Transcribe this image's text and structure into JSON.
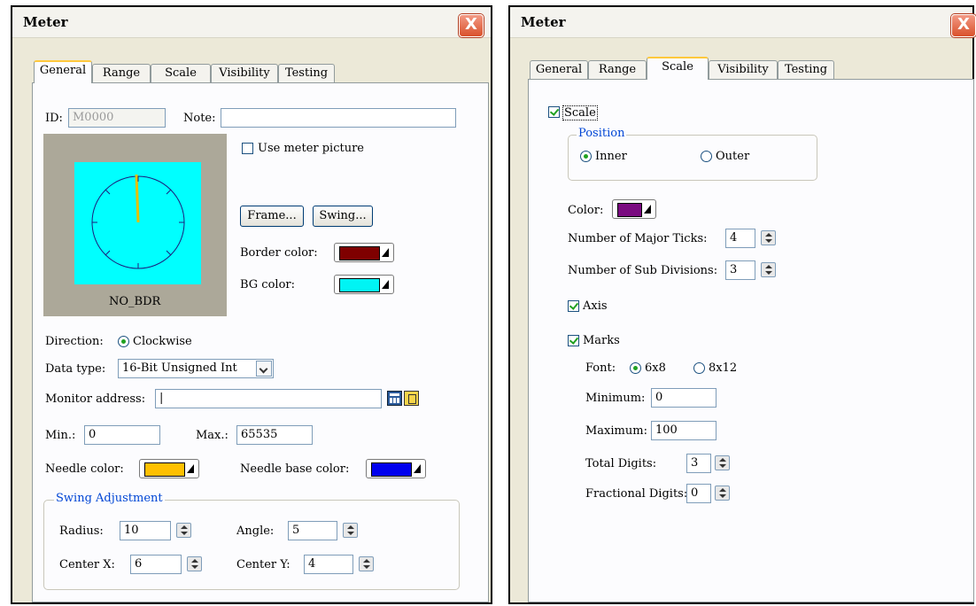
{
  "left": {
    "title": "Meter",
    "close": "X",
    "tabs": [
      "General",
      "Range",
      "Scale",
      "Visibility",
      "Testing"
    ],
    "id_label": "ID:",
    "id_value": "M0000",
    "note_label": "Note:",
    "note_value": "",
    "preview_caption": "NO_BDR",
    "use_meter_picture": "Use meter picture",
    "frame_button": "Frame...",
    "swing_button": "Swing...",
    "border_color_label": "Border color:",
    "border_color": "#7f0000",
    "bg_color_label": "BG color:",
    "bg_color": "#00f4f4",
    "direction_label": "Direction:",
    "direction_value": "Clockwise",
    "data_type_label": "Data type:",
    "data_type_value": "16-Bit Unsigned Int",
    "monitor_address_label": "Monitor address:",
    "monitor_address_value": "|",
    "min_label": "Min.:",
    "min_value": "0",
    "max_label": "Max.:",
    "max_value": "65535",
    "needle_color_label": "Needle color:",
    "needle_color": "#ffc000",
    "needle_base_color_label": "Needle base color:",
    "needle_base_color": "#0000ee",
    "swing_adjustment": {
      "legend": "Swing Adjustment",
      "radius_label": "Radius:",
      "radius_value": "10",
      "angle_label": "Angle:",
      "angle_value": "5",
      "center_x_label": "Center X:",
      "center_x_value": "6",
      "center_y_label": "Center Y:",
      "center_y_value": "4"
    }
  },
  "right": {
    "title": "Meter",
    "close": "X",
    "tabs": [
      "General",
      "Range",
      "Scale",
      "Visibility",
      "Testing"
    ],
    "scale_checkbox": "Scale",
    "position": {
      "legend": "Position",
      "inner": "Inner",
      "outer": "Outer"
    },
    "color_label": "Color:",
    "color": "#7a0a80",
    "major_ticks_label": "Number of Major Ticks:",
    "major_ticks_value": "4",
    "sub_divisions_label": "Number of Sub Divisions:",
    "sub_divisions_value": "3",
    "axis_label": "Axis",
    "marks_label": "Marks",
    "font_label": "Font:",
    "font_6x8": "6x8",
    "font_8x12": "8x12",
    "minimum_label": "Minimum:",
    "minimum_value": "0",
    "maximum_label": "Maximum:",
    "maximum_value": "100",
    "total_digits_label": "Total Digits:",
    "total_digits_value": "3",
    "fractional_digits_label": "Fractional Digits:",
    "fractional_digits_value": "0"
  }
}
